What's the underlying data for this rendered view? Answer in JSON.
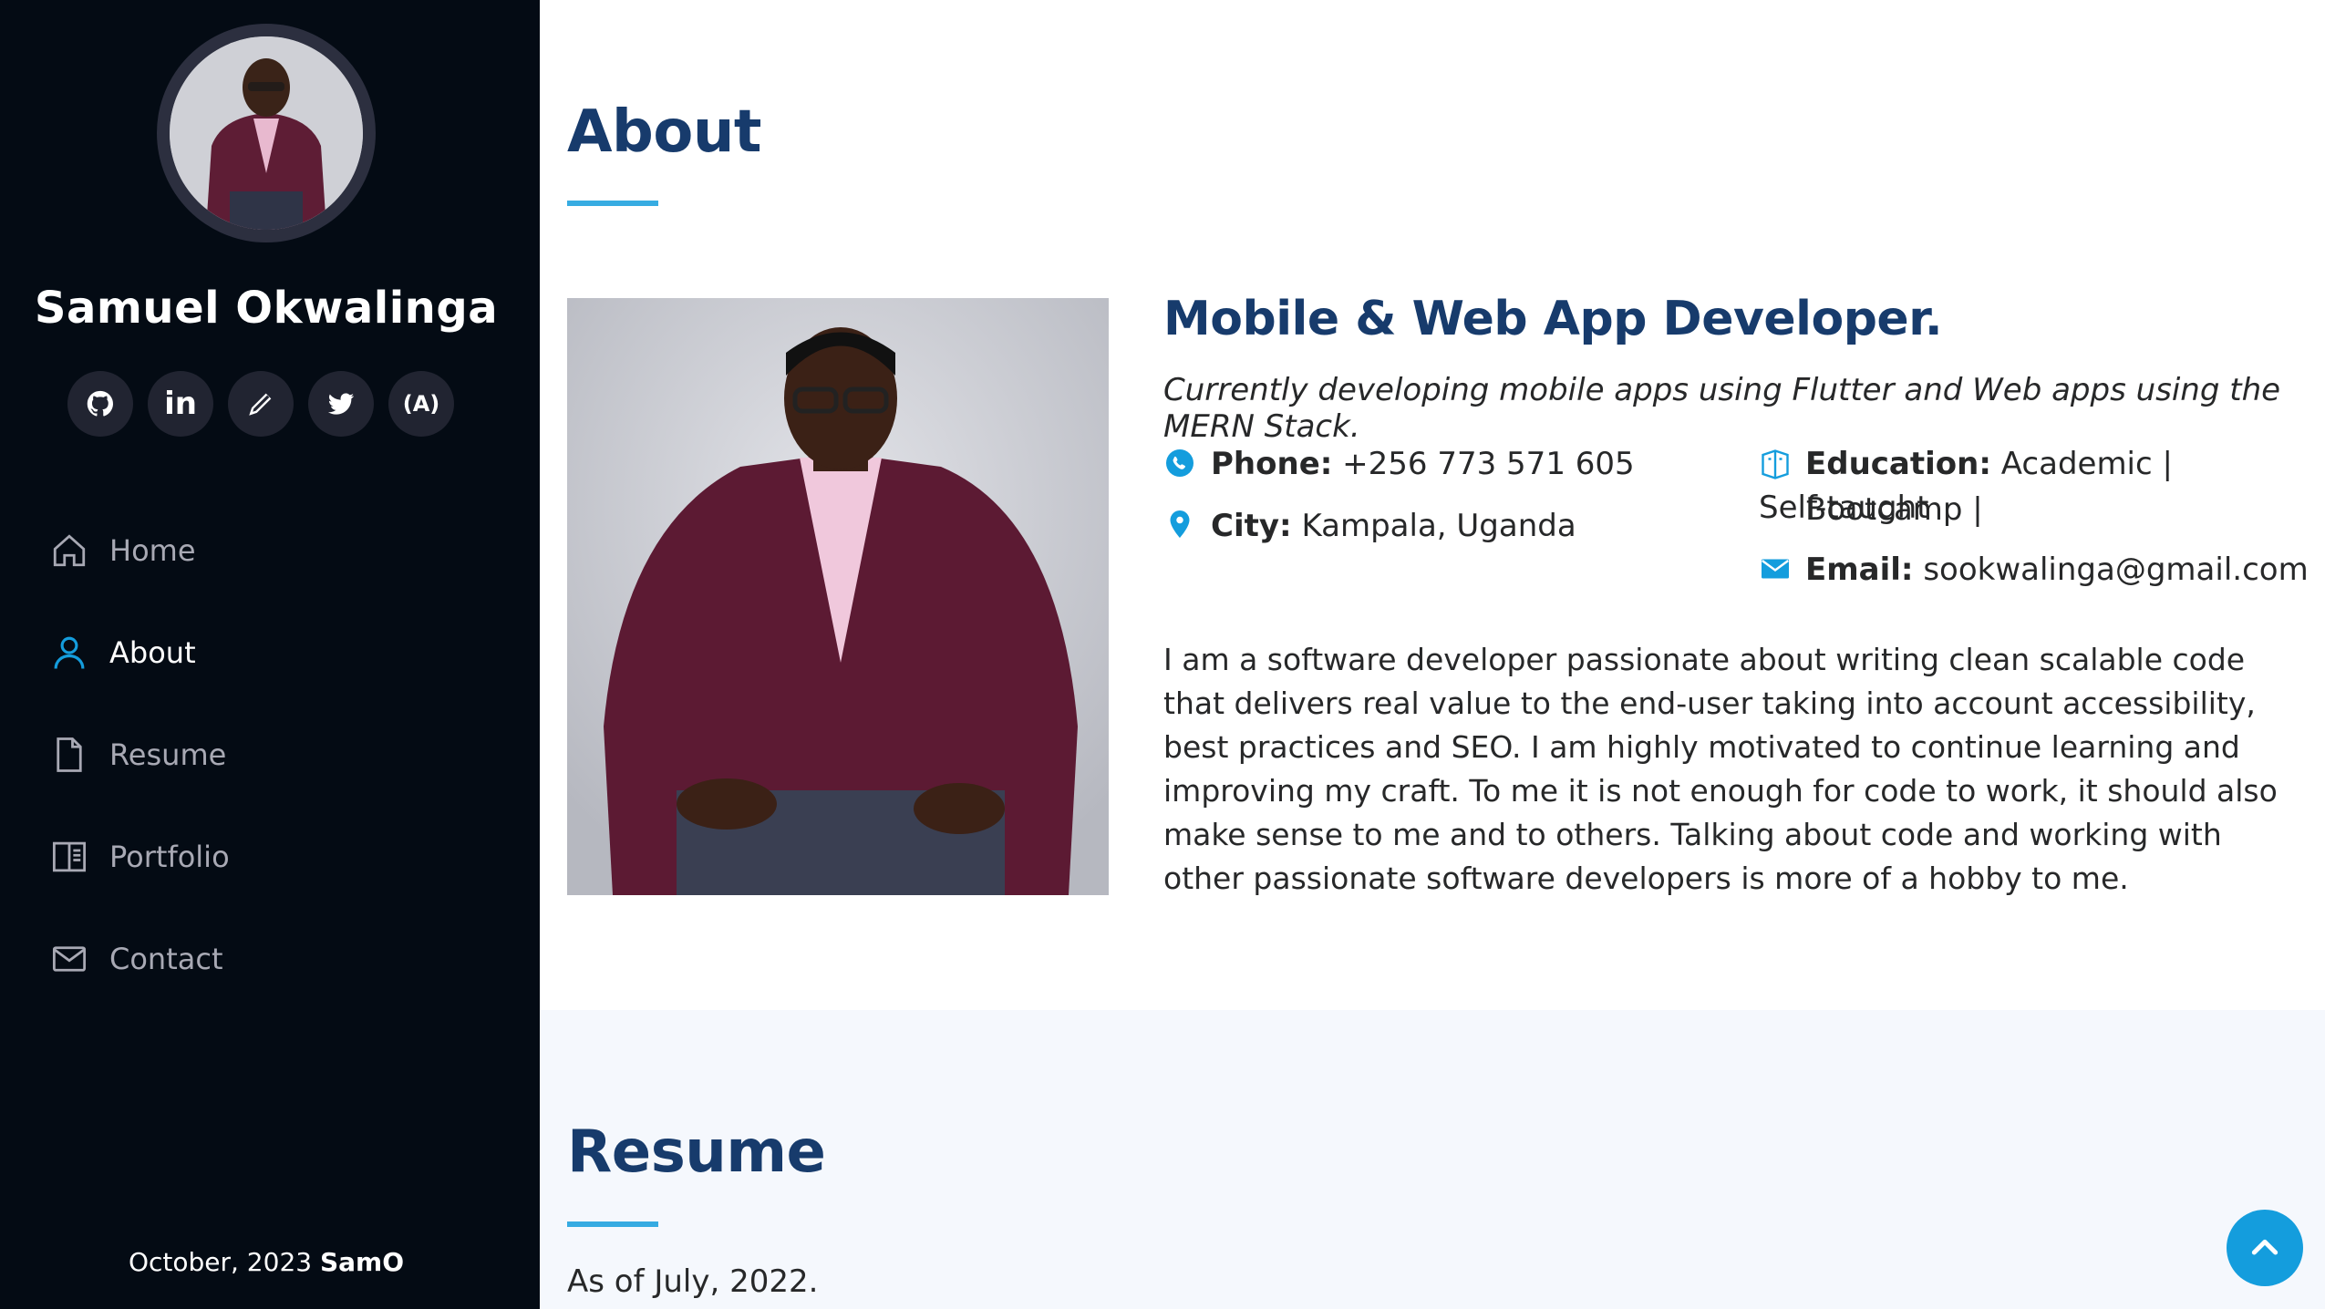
{
  "profile": {
    "name": "Samuel Okwalinga",
    "social": [
      {
        "icon": "github-icon",
        "label": ""
      },
      {
        "icon": "linkedin-icon",
        "label": "in"
      },
      {
        "icon": "pen-icon",
        "label": ""
      },
      {
        "icon": "twitter-icon",
        "label": ""
      },
      {
        "icon": "freecodecamp-icon",
        "label": "(A)"
      }
    ]
  },
  "nav": {
    "items": [
      {
        "label": "Home",
        "icon": "house-icon",
        "active": false
      },
      {
        "label": "About",
        "icon": "person-icon",
        "active": true
      },
      {
        "label": "Resume",
        "icon": "file-icon",
        "active": false
      },
      {
        "label": "Portfolio",
        "icon": "book-icon",
        "active": false
      },
      {
        "label": "Contact",
        "icon": "envelope-icon",
        "active": false
      }
    ]
  },
  "footer": {
    "date": "October, 2023",
    "brand": "SamO"
  },
  "about": {
    "title": "About",
    "role": "Mobile & Web App Developer.",
    "tagline": "Currently developing mobile apps using Flutter and Web apps using the MERN Stack.",
    "phone_label": "Phone:",
    "phone_value": "+256 773 571 605",
    "city_label": "City:",
    "city_value": "Kampala, Uganda",
    "education_label": "Education:",
    "education_value_line1": "Academic | Bootcamp |",
    "education_value_line2": "Self-taught",
    "email_label": "Email:",
    "email_value": "sookwalinga@gmail.com",
    "bio": "I am a software developer passionate about writing clean scalable code that delivers real value to the end-user taking into account accessibility, best practices and SEO. I am highly motivated to continue learning and improving my craft. To me it is not enough for code to work, it should also make sense to me and to others. Talking about code and working with other passionate software developers is more of a hobby to me."
  },
  "resume": {
    "title": "Resume",
    "as_of": "As of July, 2022."
  },
  "colors": {
    "sidebar_bg": "#040b14",
    "accent": "#149ddd",
    "heading": "#173b6c"
  }
}
